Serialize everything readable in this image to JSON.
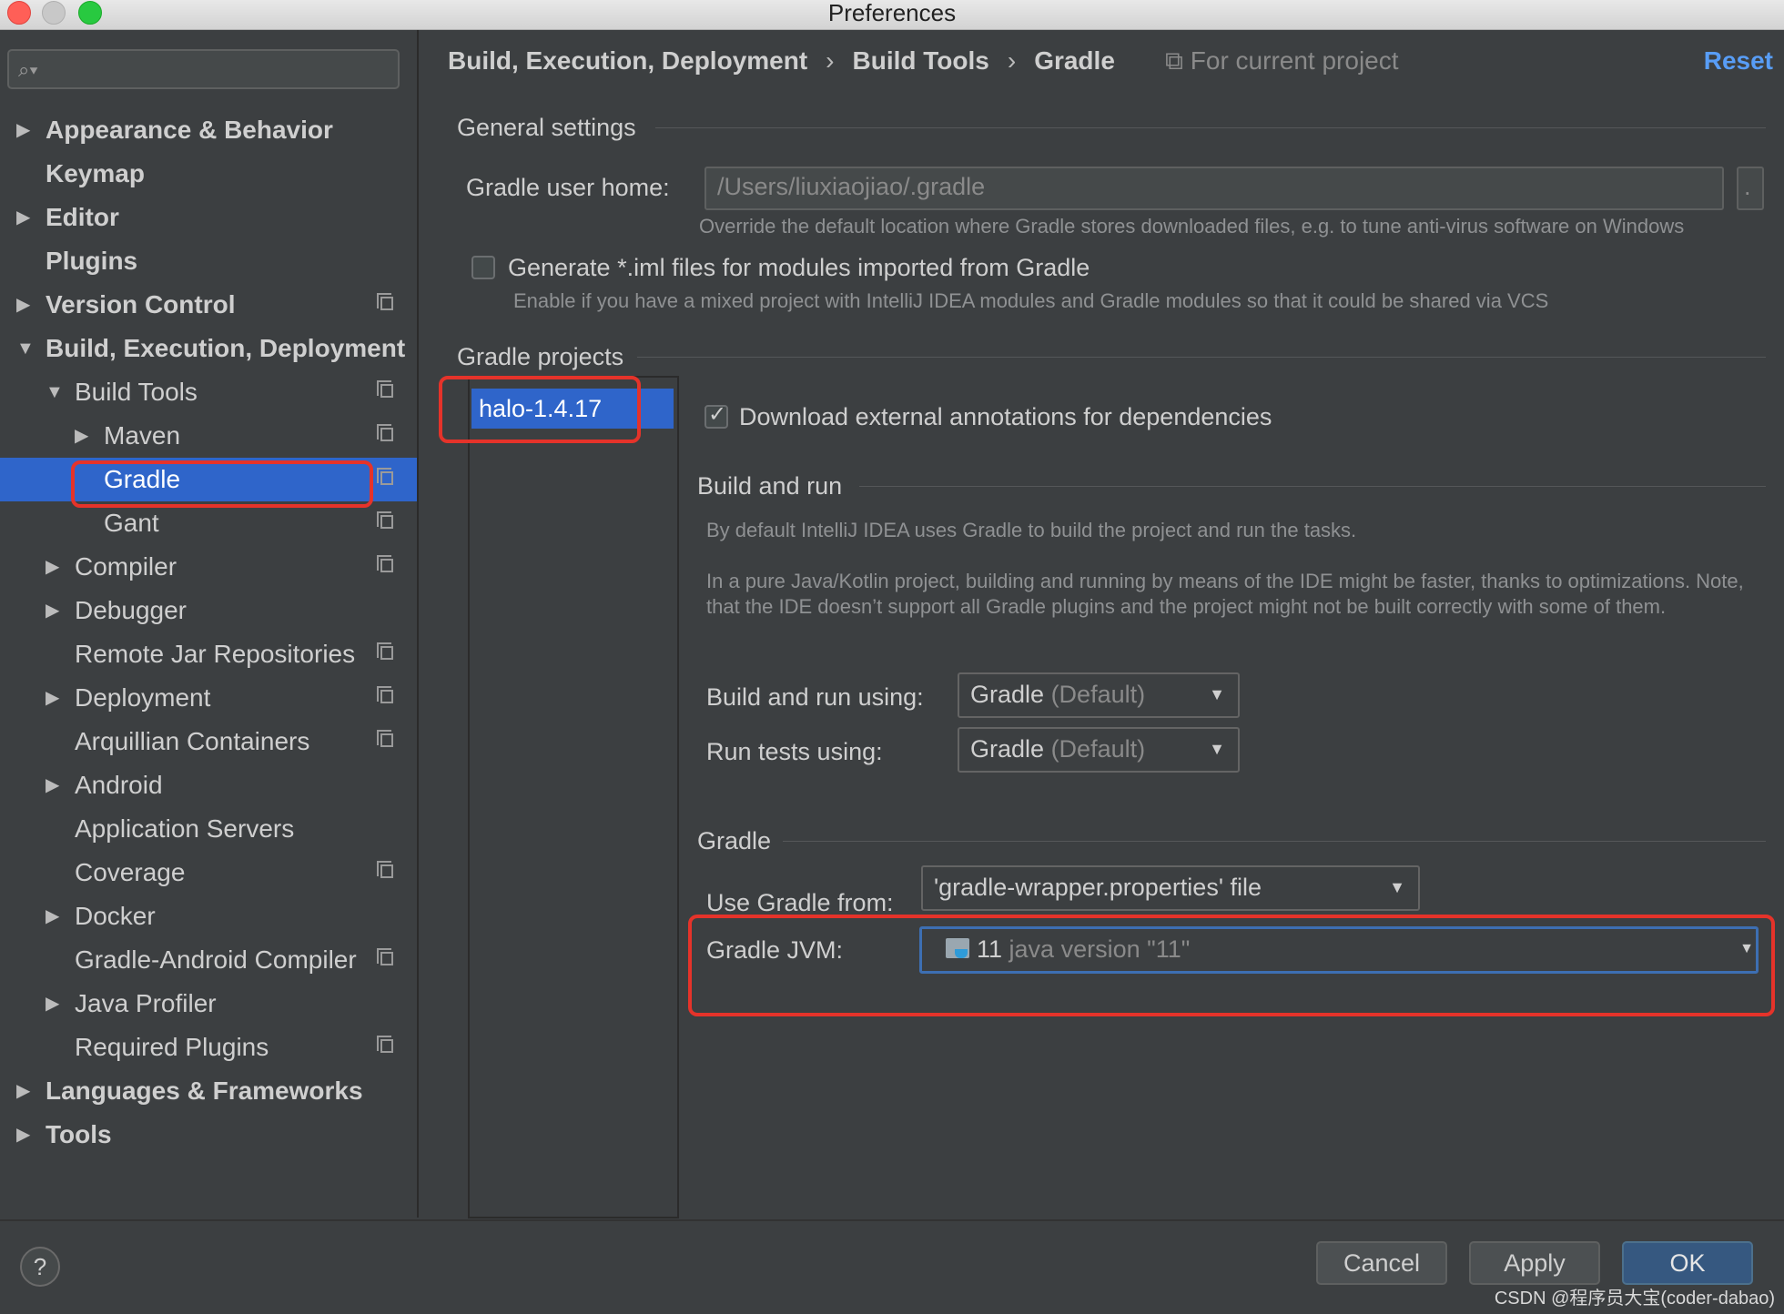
{
  "window": {
    "title": "Preferences"
  },
  "sidebar": {
    "search_placeholder": "",
    "items": [
      {
        "label": "Appearance & Behavior"
      },
      {
        "label": "Keymap"
      },
      {
        "label": "Editor"
      },
      {
        "label": "Plugins"
      },
      {
        "label": "Version Control"
      },
      {
        "label": "Build, Execution, Deployment"
      },
      {
        "label": "Build Tools"
      },
      {
        "label": "Maven"
      },
      {
        "label": "Gradle"
      },
      {
        "label": "Gant"
      },
      {
        "label": "Compiler"
      },
      {
        "label": "Debugger"
      },
      {
        "label": "Remote Jar Repositories"
      },
      {
        "label": "Deployment"
      },
      {
        "label": "Arquillian Containers"
      },
      {
        "label": "Android"
      },
      {
        "label": "Application Servers"
      },
      {
        "label": "Coverage"
      },
      {
        "label": "Docker"
      },
      {
        "label": "Gradle-Android Compiler"
      },
      {
        "label": "Java Profiler"
      },
      {
        "label": "Required Plugins"
      },
      {
        "label": "Languages & Frameworks"
      },
      {
        "label": "Tools"
      }
    ]
  },
  "header": {
    "crumb1": "Build, Execution, Deployment",
    "crumb2": "Build Tools",
    "crumb3": "Gradle",
    "separator": "›",
    "scope": "For current project",
    "reset": "Reset"
  },
  "general": {
    "title": "General settings",
    "user_home_label": "Gradle user home:",
    "user_home_value": "/Users/liuxiaojiao/.gradle",
    "user_home_hint": "Override the default location where Gradle stores downloaded files, e.g. to tune anti-virus software on Windows",
    "iml_label": "Generate *.iml files for modules imported from Gradle",
    "iml_hint": "Enable if you have a mixed project with IntelliJ IDEA modules and Gradle modules so that it could be shared via VCS"
  },
  "projects": {
    "title": "Gradle projects",
    "list": [
      "halo-1.4.17"
    ],
    "annotations_label": "Download external annotations for dependencies"
  },
  "build_run": {
    "title": "Build and run",
    "hint1": "By default IntelliJ IDEA uses Gradle to build the project and run the tasks.",
    "hint2": "In a pure Java/Kotlin project, building and running by means of the IDE might be faster, thanks to optimizations. Note, that the IDE doesn’t support all Gradle plugins and the project might not be built correctly with some of them.",
    "build_using_label": "Build and run using:",
    "build_using_value": "Gradle",
    "build_using_default": "(Default)",
    "tests_using_label": "Run tests using:",
    "tests_using_value": "Gradle",
    "tests_using_default": "(Default)"
  },
  "gradle": {
    "title": "Gradle",
    "use_from_label": "Use Gradle from:",
    "use_from_value": "'gradle-wrapper.properties' file",
    "jvm_label": "Gradle JVM:",
    "jvm_value": "11",
    "jvm_desc": "java version \"11\""
  },
  "footer": {
    "help": "?",
    "cancel": "Cancel",
    "apply": "Apply",
    "ok": "OK",
    "watermark": "CSDN @程序员大宝(coder-dabao)"
  },
  "colors": {
    "selection": "#2f65ca",
    "link": "#589df6",
    "highlight_box": "#e5332a"
  }
}
